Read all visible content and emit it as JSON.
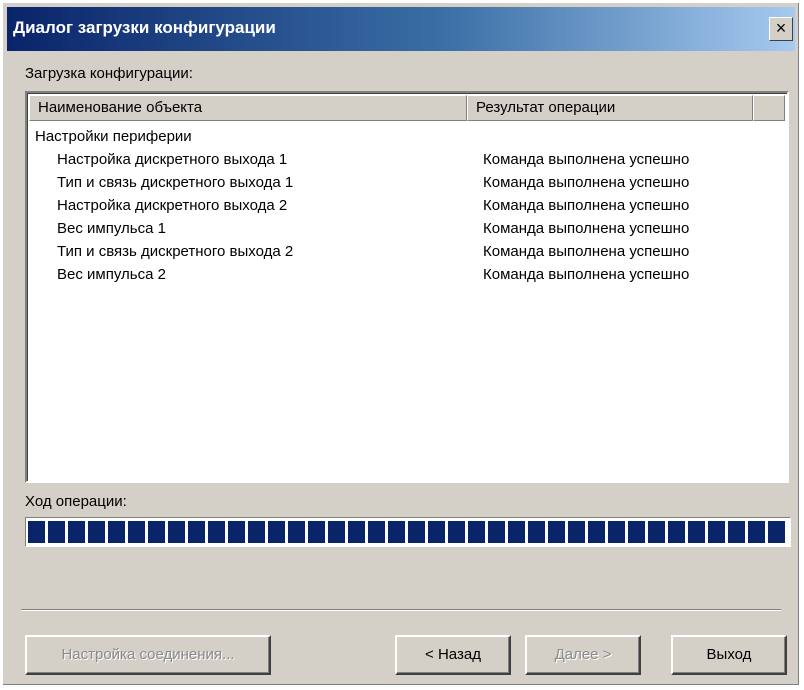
{
  "window": {
    "title": "Диалог загрузки конфигурации",
    "close_glyph": "×"
  },
  "list": {
    "label": "Загрузка конфигурации:",
    "columns": [
      "Наименование объекта",
      "Результат операции",
      ""
    ],
    "group": "Настройки периферии",
    "items": [
      {
        "name": "Настройка дискретного выхода 1",
        "result": "Команда выполнена успешно"
      },
      {
        "name": "Тип и связь дискретного выхода 1",
        "result": "Команда выполнена успешно"
      },
      {
        "name": "Настройка дискретного выхода 2",
        "result": "Команда выполнена успешно"
      },
      {
        "name": "Вес импульса 1",
        "result": "Команда выполнена успешно"
      },
      {
        "name": "Тип и связь дискретного выхода 2",
        "result": "Команда выполнена успешно"
      },
      {
        "name": "Вес импульса 2",
        "result": "Команда выполнена успешно"
      }
    ]
  },
  "progress": {
    "label": "Ход операции:",
    "value_percent": 100,
    "color": "#0a246a"
  },
  "buttons": {
    "connection_settings": "Настройка соединения...",
    "back": "< Назад",
    "next": "Далее >",
    "exit": "Выход"
  }
}
